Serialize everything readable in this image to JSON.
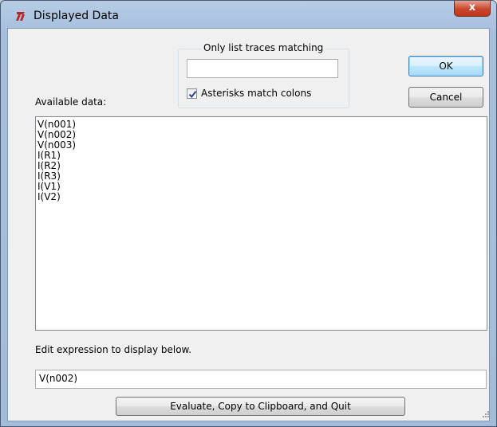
{
  "window": {
    "title": "Displayed Data",
    "close_glyph": "x"
  },
  "filter": {
    "group_label": "Only list traces matching",
    "value": "",
    "asterisk_checkbox_label": "Asterisks match colons",
    "asterisk_checked": true
  },
  "buttons": {
    "ok": "OK",
    "cancel": "Cancel",
    "evaluate": "Evaluate, Copy to Clipboard, and Quit"
  },
  "available": {
    "label": "Available data:",
    "items": [
      "V(n001)",
      "V(n002)",
      "V(n003)",
      "I(R1)",
      "I(R2)",
      "I(R3)",
      "I(V1)",
      "I(V2)"
    ]
  },
  "expression": {
    "label": "Edit expression to display below.",
    "value": "V(n002)"
  },
  "colors": {
    "title_icon": "#c0392b",
    "close_button": "#c7452c",
    "check_mark": "#2a3f8a"
  }
}
